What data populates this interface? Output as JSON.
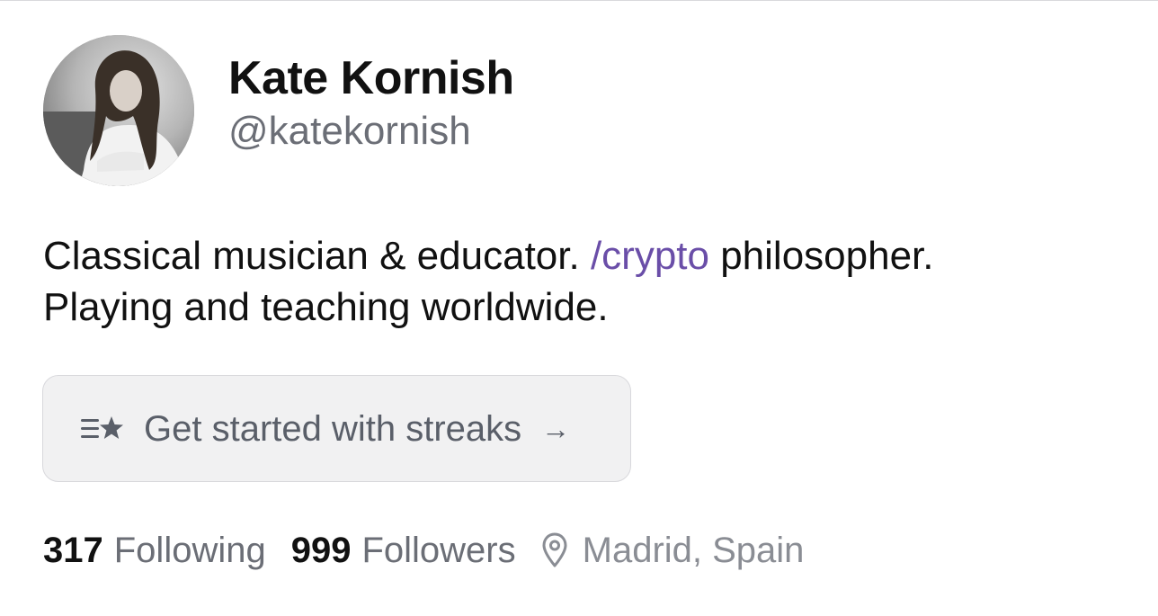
{
  "profile": {
    "display_name": "Kate Kornish",
    "handle": "@katekornish",
    "avatar_alt": "profile photo"
  },
  "bio": {
    "line1_before": "Classical musician & educator. ",
    "channel": "/crypto",
    "line1_after": " philosopher.",
    "line2": "Playing and teaching worldwide."
  },
  "streaks_button": {
    "label": "Get started with streaks",
    "arrow": "→",
    "icon": "list-star-icon"
  },
  "stats": {
    "following_count": "317",
    "following_label": "Following",
    "followers_count": "999",
    "followers_label": "Followers",
    "location": "Madrid, Spain",
    "location_icon": "map-pin-icon"
  },
  "colors": {
    "channel_accent": "#6a4ea8",
    "secondary_text": "#6b6e76",
    "button_bg": "#f1f1f2"
  }
}
